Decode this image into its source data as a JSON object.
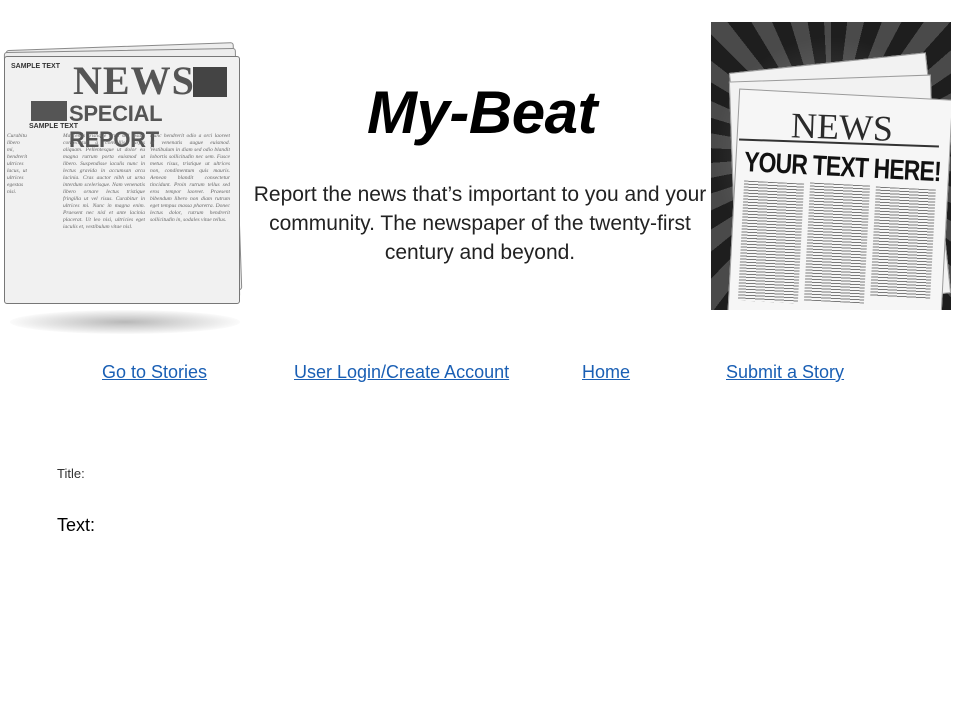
{
  "site": {
    "title": "My-Beat",
    "tagline": "Report the news that’s important to you and your community. The newspaper of the twenty-first century and beyond."
  },
  "nav": {
    "items": [
      {
        "label": "Go to Stories"
      },
      {
        "label": "User Login/Create Account"
      },
      {
        "label": "Home"
      },
      {
        "label": "Submit a Story"
      }
    ]
  },
  "form": {
    "title_label": "Title:",
    "text_label": "Text:"
  },
  "images": {
    "left": {
      "sample_text_1": "SAMPLE TEXT",
      "masthead": "NEWS",
      "subhead": "SPECIAL REPORT",
      "sample_text_2": "SAMPLE TEXT",
      "column_1": "Maecenas tristique urna sed ipsum consectetur a convallis turpis aliquam. Pellentesque ut dolor eu magna rutrum porta euismod ut libero. Suspendisse iaculis nunc in lectus gravida in accumsan arcu lacinia. Cras auctor nibh ut urna interdum scelerisque. Nam venenatis libero ornare lectus tristique fringilla ut vel risus. Curabitur in ultrices mi. Nunc in magna enim. Praesent nec nisl et ante lacinia placerat. Ut leo nisi, ultricies eget iaculis et, vestibulum vitae nisl.",
      "column_2": "Nunc hendrerit odio a orci laoreet id venenatis augue euismod. Vestibulum in diam sed odio blandit lobortis sollicitudin nec sem. Fusce metus risus, tristique ut ultrices non, condimentum quis mauris. Aenean blandit consectetur tincidunt. Proin rutrum tellus sed eros tempor laoreet. Praesent bibendum libero non diam rutrum eget tempus massa pharetra. Donec lectus dolor, rutrum hendrerit sollicitudin in, sodales vitae tellus.",
      "column_side": "Curabitur libero mi, hendrerit ultrices lacus, ut ultrices egestas nisi."
    },
    "right": {
      "masthead": "NEWS",
      "headline": "YOUR TEXT HERE!"
    }
  },
  "colors": {
    "link": "#1a5fb4",
    "background": "#ffffff"
  }
}
